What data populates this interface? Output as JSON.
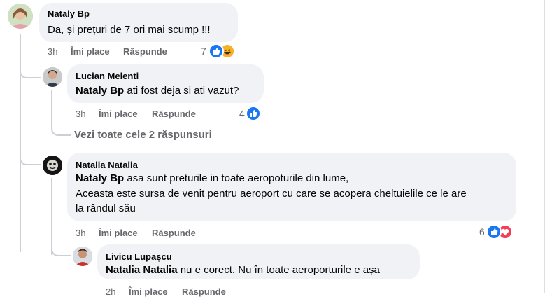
{
  "comments": [
    {
      "author": "Nataly Bp",
      "text": "Da, și prețuri de 7 ori mai scump !!!",
      "time": "3h",
      "like": "Îmi place",
      "reply": "Răspunde",
      "reactions_count": "7",
      "reactions": [
        "like-icon",
        "haha-icon"
      ],
      "replies": [
        {
          "author": "Lucian Melenti",
          "mention": "Nataly Bp",
          "text": " ati fost deja si ati vazut?",
          "time": "3h",
          "like": "Îmi place",
          "reply": "Răspunde",
          "reactions_count": "4",
          "reactions": [
            "like-icon"
          ]
        }
      ],
      "see_all_replies": "Vezi toate cele 2 răspunsuri"
    },
    {
      "author": "Natalia Natalia",
      "mention": "Nataly Bp",
      "text_line1": " asa sunt preturile in toate aeropoturile din lume,",
      "text_line2": "Aceasta este sursa de venit pentru aeroport cu care se acopera cheltuielile ce le are",
      "text_line3": "la rândul său",
      "time": "3h",
      "like": "Îmi place",
      "reply": "Răspunde",
      "reactions_count": "6",
      "reactions": [
        "like-icon",
        "heart-icon"
      ],
      "replies": [
        {
          "author": "Livicu Lupașcu",
          "mention": "Natalia Natalia",
          "text": " nu e corect. Nu în toate aeroporturile e așa",
          "time": "2h",
          "like": "Îmi place",
          "reply": "Răspunde"
        }
      ]
    }
  ],
  "colors": {
    "bubble": "#f0f2f5",
    "meta_text": "#65676b",
    "like_blue": "#1877f2",
    "heart_red": "#f33e58",
    "haha_yellow": "#f7b125",
    "thread_line": "#ccd0d5"
  }
}
